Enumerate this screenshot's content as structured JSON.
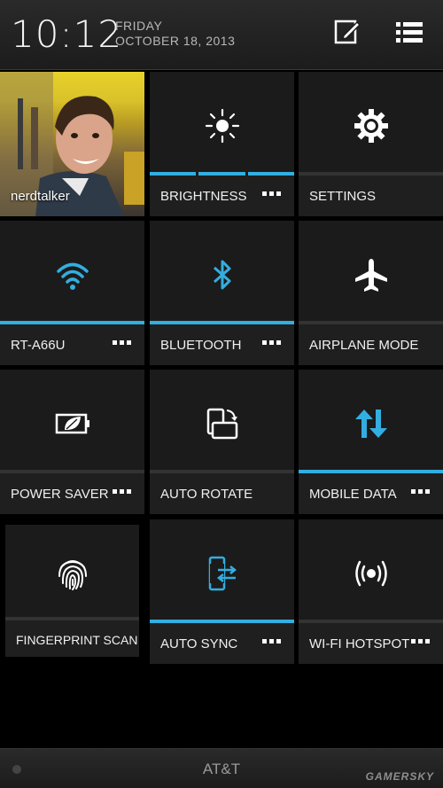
{
  "status": {
    "time": "10:12",
    "day": "FRIDAY",
    "date": "OCTOBER 18, 2013"
  },
  "header": {
    "edit_icon": "edit-icon",
    "list_icon": "list-icon"
  },
  "profile": {
    "name": "nerdtalker"
  },
  "tiles": [
    {
      "label": "BRIGHTNESS",
      "icon": "brightness-icon",
      "active": true,
      "more": true
    },
    {
      "label": "SETTINGS",
      "icon": "gear-icon",
      "active": false,
      "more": false
    },
    {
      "label": "RT-A66U",
      "icon": "wifi-icon",
      "active": true,
      "more": true
    },
    {
      "label": "BLUETOOTH",
      "icon": "bluetooth-icon",
      "active": true,
      "more": true
    },
    {
      "label": "AIRPLANE MODE",
      "icon": "airplane-icon",
      "active": false,
      "more": false
    },
    {
      "label": "POWER SAVER",
      "icon": "power-saver-icon",
      "active": false,
      "more": true
    },
    {
      "label": "AUTO ROTATE",
      "icon": "auto-rotate-icon",
      "active": false,
      "more": false
    },
    {
      "label": "MOBILE DATA",
      "icon": "mobile-data-icon",
      "active": true,
      "more": true
    },
    {
      "label": "FINGERPRINT SCAN",
      "icon": "fingerprint-icon",
      "active": false,
      "more": false
    },
    {
      "label": "AUTO SYNC",
      "icon": "auto-sync-icon",
      "active": true,
      "more": true
    },
    {
      "label": "WI-FI HOTSPOT",
      "icon": "hotspot-icon",
      "active": false,
      "more": true
    }
  ],
  "colors": {
    "accent": "#33aee0",
    "tile": "#1b1b1b",
    "background": "#000000"
  },
  "carrier": "AT&T",
  "watermark": "GAMERSKY"
}
